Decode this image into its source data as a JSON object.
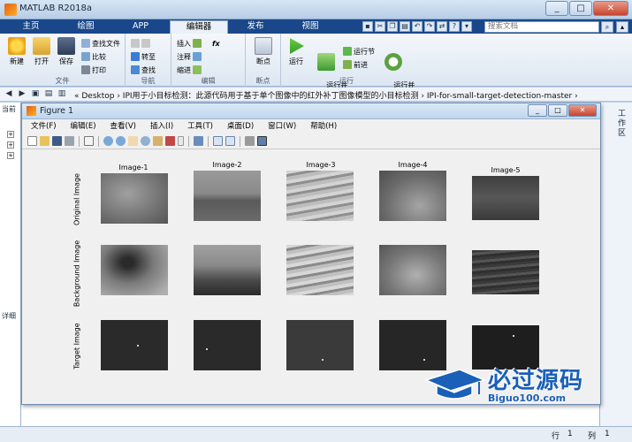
{
  "window": {
    "title": "MATLAB R2018a",
    "min": "_",
    "max": "□",
    "close": "✕"
  },
  "tabs": [
    "主页",
    "绘图",
    "APP",
    "编辑器",
    "发布",
    "视图"
  ],
  "search": {
    "placeholder": "搜索文档"
  },
  "ribbon": {
    "file_group": {
      "label": "文件",
      "new": "新建",
      "open": "打开",
      "save": "保存",
      "find_files": "查找文件",
      "compare": "比较",
      "print": "打印"
    },
    "nav_group": {
      "label": "导航",
      "goto": "转至",
      "find": "查找"
    },
    "edit_group": {
      "label": "编辑",
      "insert": "插入",
      "comment": "注释",
      "indent": "缩进",
      "fx": "fx"
    },
    "breakpoint_group": {
      "label": "断点",
      "breakpoints": "断点"
    },
    "run_group": {
      "label": "运行",
      "run": "运行",
      "run_advance": "运行并\n前进",
      "run_section": "运行节",
      "advance": "前进",
      "run_time": "运行并\n计时"
    }
  },
  "address": {
    "path": "« Desktop › IPI用于小目标检测：此源代码用于基于单个图像中的红外补丁图像模型的小目标检测 › IPI-for-small-target-detection-master ›"
  },
  "left_panel": {
    "header": "当前",
    "detail": "详细"
  },
  "right_panel": {
    "label": "工作区"
  },
  "status": {
    "row_label": "行",
    "row": "1",
    "col_label": "列",
    "col": "1"
  },
  "figure": {
    "title": "Figure 1",
    "menu": [
      "文件(F)",
      "编辑(E)",
      "查看(V)",
      "插入(I)",
      "工具(T)",
      "桌面(D)",
      "窗口(W)",
      "帮助(H)"
    ],
    "columns": [
      "Image-1",
      "Image-2",
      "Image-3",
      "Image-4",
      "Image-5"
    ],
    "rows": [
      "Original Image",
      "Background Image",
      "Target Image"
    ]
  },
  "watermark": {
    "big": "必过源码",
    "small": "Biguo100.com"
  }
}
